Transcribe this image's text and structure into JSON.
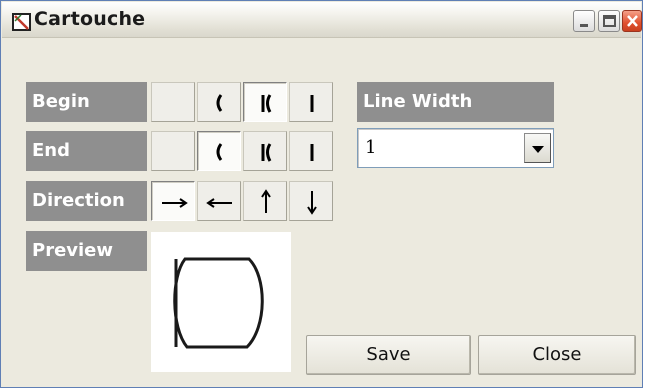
{
  "window": {
    "title": "Cartouche",
    "icons": {
      "app": "cartouche-app-icon",
      "minimize": "minimize-icon",
      "maximize": "maximize-icon",
      "close": "close-icon"
    }
  },
  "rows": {
    "begin": {
      "label": "Begin",
      "options": [
        "none",
        "paren",
        "bar-paren",
        "bar"
      ],
      "selected": "bar-paren"
    },
    "end": {
      "label": "End",
      "options": [
        "none",
        "paren",
        "bar-paren",
        "bar"
      ],
      "selected": "paren"
    },
    "direction": {
      "label": "Direction",
      "options": [
        "→",
        "←",
        "↑",
        "↓"
      ],
      "selected": "→"
    },
    "preview": {
      "label": "Preview"
    }
  },
  "line_width": {
    "label": "Line Width",
    "value": "1"
  },
  "buttons": {
    "save": "Save",
    "close": "Close"
  }
}
